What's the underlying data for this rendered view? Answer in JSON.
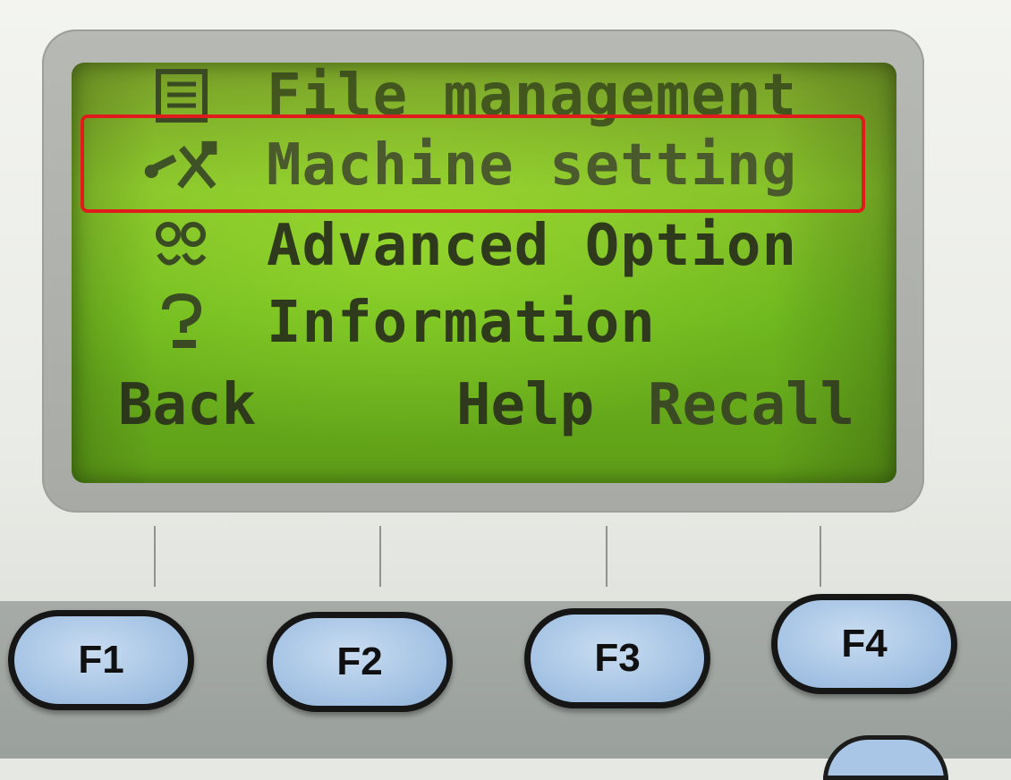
{
  "screen": {
    "menu": [
      {
        "icon": "file-icon",
        "label": "File management"
      },
      {
        "icon": "wrench-hammer-icon",
        "label": "Machine setting",
        "highlighted": true
      },
      {
        "icon": "advanced-option-icon",
        "label": "Advanced Option"
      },
      {
        "icon": "question-mark-icon",
        "label": "Information"
      }
    ],
    "softkeys": {
      "back": "Back",
      "help": "Help",
      "recall": "Recall"
    }
  },
  "function_keys": [
    "F1",
    "F2",
    "F3",
    "F4"
  ],
  "colors": {
    "lcd_background": "#86c22a",
    "lcd_text": "#2e3a1b",
    "highlight_border": "#e11b1b",
    "key_fill": "#a9c6e6"
  }
}
